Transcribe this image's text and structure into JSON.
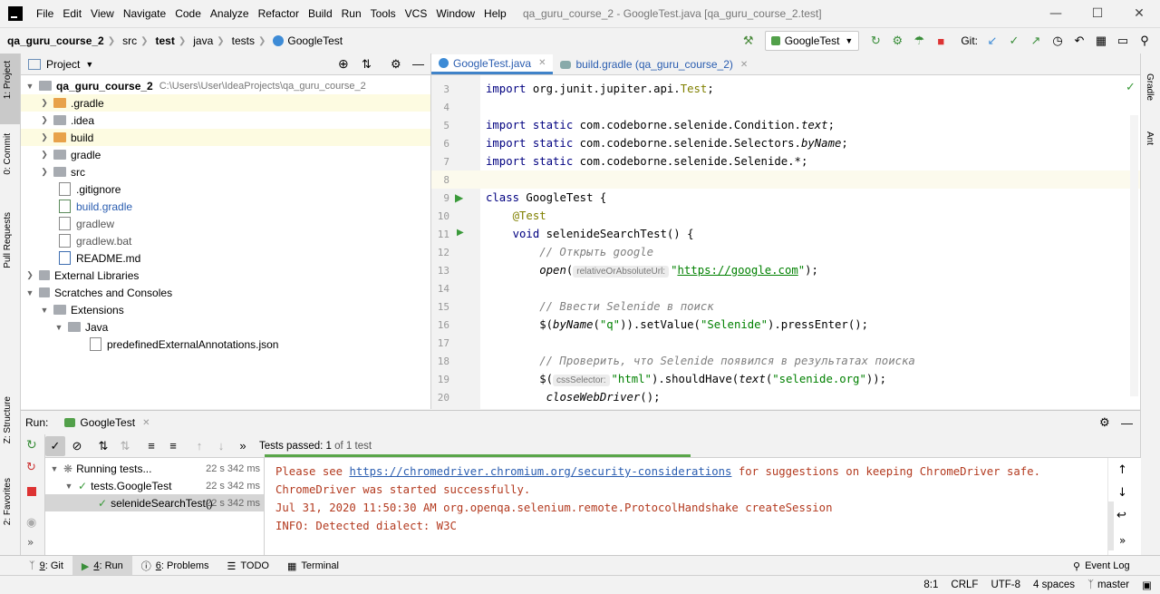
{
  "window": {
    "title": "qa_guru_course_2 - GoogleTest.java [qa_guru_course_2.test]",
    "menu": [
      "File",
      "Edit",
      "View",
      "Navigate",
      "Code",
      "Analyze",
      "Refactor",
      "Build",
      "Run",
      "Tools",
      "VCS",
      "Window",
      "Help"
    ]
  },
  "breadcrumb": [
    "qa_guru_course_2",
    "src",
    "test",
    "java",
    "tests",
    "GoogleTest"
  ],
  "toolbar": {
    "run_config": "GoogleTest",
    "git_label": "Git:"
  },
  "left_stripe": [
    "1: Project",
    "0: Commit",
    "Pull Requests",
    "Z: Structure",
    "2: Favorites"
  ],
  "right_stripe": [
    "Gradle",
    "Ant"
  ],
  "project": {
    "header": "Project",
    "tree": [
      {
        "label": "qa_guru_course_2",
        "path": "C:\\Users\\User\\IdeaProjects\\qa_guru_course_2"
      },
      {
        "label": ".gradle"
      },
      {
        "label": ".idea"
      },
      {
        "label": "build"
      },
      {
        "label": "gradle"
      },
      {
        "label": "src"
      },
      {
        "label": ".gitignore"
      },
      {
        "label": "build.gradle"
      },
      {
        "label": "gradlew"
      },
      {
        "label": "gradlew.bat"
      },
      {
        "label": "README.md"
      },
      {
        "label": "External Libraries"
      },
      {
        "label": "Scratches and Consoles"
      },
      {
        "label": "Extensions"
      },
      {
        "label": "Java"
      },
      {
        "label": "predefinedExternalAnnotations.json"
      }
    ]
  },
  "editor": {
    "tabs": [
      {
        "label": "GoogleTest.java",
        "active": true
      },
      {
        "label": "build.gradle (qa_guru_course_2)",
        "active": false
      }
    ],
    "line_numbers": [
      "3",
      "4",
      "5",
      "6",
      "7",
      "8",
      "9",
      "10",
      "11",
      "12",
      "13",
      "14",
      "15",
      "16",
      "17",
      "18",
      "19",
      "20"
    ],
    "code": {
      "l3a": "import",
      "l3b": " org.junit.jupiter.api.",
      "l3c": "Test",
      "l3d": ";",
      "l5a": "import static",
      "l5b": " com.codeborne.selenide.Condition.",
      "l5c": "text",
      "l5d": ";",
      "l6a": "import static",
      "l6b": " com.codeborne.selenide.Selectors.",
      "l6c": "byName",
      "l6d": ";",
      "l7a": "import static",
      "l7b": " com.codeborne.selenide.Selenide.*;",
      "l9a": "class",
      "l9b": " GoogleTest {",
      "l10": "    @Test",
      "l11a": "    void",
      "l11b": " selenideSearchTest() {",
      "l12": "        // Открыть google",
      "l13a": "        ",
      "l13b": "open",
      "l13c": "(",
      "l13hint": "relativeOrAbsoluteUrl:",
      "l13d": "\"",
      "l13url": "https://google.com",
      "l13e": "\"",
      "l13f": ");",
      "l15": "        // Ввести Selenide в поиск",
      "l16a": "        $(",
      "l16b": "byName",
      "l16c": "(",
      "l16d": "\"q\"",
      "l16e": ")).setValue(",
      "l16f": "\"Selenide\"",
      "l16g": ").pressEnter();",
      "l18": "        // Проверить, что Selenide появился в результатах поиска",
      "l19a": "        $(",
      "l19hint": "cssSelector:",
      "l19b": "\"html\"",
      "l19c": ").shouldHave(",
      "l19d": "text",
      "l19e": "(",
      "l19f": "\"selenide.org\"",
      "l19g": "));",
      "l20a": "         ",
      "l20b": "closeWebDriver",
      "l20c": "();"
    }
  },
  "run": {
    "label": "Run:",
    "tab": "GoogleTest",
    "status_prefix": "Tests passed:",
    "status_count": "1",
    "status_suffix": "of 1 test",
    "tree": [
      {
        "label": "Running tests...",
        "duration": "22 s 342 ms"
      },
      {
        "label": "tests.GoogleTest",
        "duration": "22 s 342 ms"
      },
      {
        "label": "selenideSearchTest()",
        "duration": "22 s 342 ms"
      }
    ],
    "console": {
      "line1a": "Please see ",
      "line1link": "https://chromedriver.chromium.org/security-considerations",
      "line1b": " for suggestions on keeping ChromeDriver safe.",
      "line2": "ChromeDriver was started successfully.",
      "line3": "Jul 31, 2020 11:50:30 AM org.openqa.selenium.remote.ProtocolHandshake createSession",
      "line4": "INFO: Detected dialect: W3C"
    }
  },
  "bottom_tabs": [
    {
      "num": "9",
      "label": ": Git"
    },
    {
      "num": "4",
      "label": ": Run"
    },
    {
      "num": "6",
      "label": ": Problems"
    },
    {
      "num": "",
      "label": "TODO"
    },
    {
      "num": "",
      "label": "Terminal"
    }
  ],
  "event_log": "Event Log",
  "status": {
    "position": "8:1",
    "line_sep": "CRLF",
    "encoding": "UTF-8",
    "indent": "4 spaces",
    "branch": "master"
  }
}
